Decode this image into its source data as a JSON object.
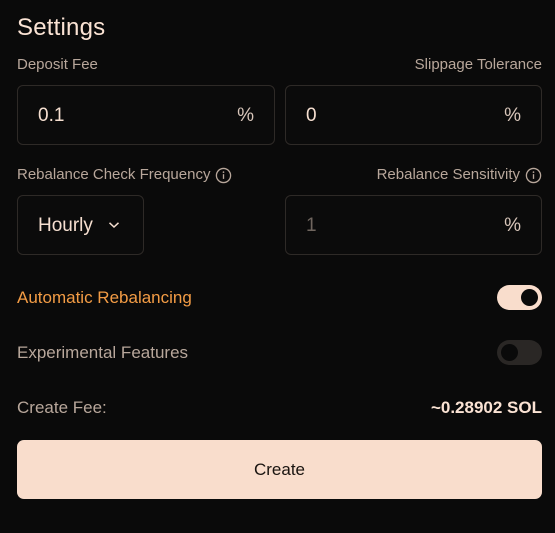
{
  "title": "Settings",
  "deposit_fee": {
    "label": "Deposit Fee",
    "value": "0.1",
    "unit": "%"
  },
  "slippage": {
    "label": "Slippage Tolerance",
    "value": "0",
    "unit": "%"
  },
  "rebalance_frequency": {
    "label": "Rebalance Check Frequency",
    "selected": "Hourly",
    "icon": "info-icon"
  },
  "rebalance_sensitivity": {
    "label": "Rebalance Sensitivity",
    "value": "1",
    "unit": "%",
    "icon": "info-icon"
  },
  "automatic_rebalancing": {
    "label": "Automatic Rebalancing",
    "enabled": true
  },
  "experimental_features": {
    "label": "Experimental Features",
    "enabled": false
  },
  "create_fee": {
    "label": "Create Fee:",
    "value": "~0.28902 SOL"
  },
  "create_button": {
    "label": "Create"
  },
  "colors": {
    "accent": "#f39c45",
    "button": "#f9ddcc",
    "background": "#0a0a0a"
  }
}
